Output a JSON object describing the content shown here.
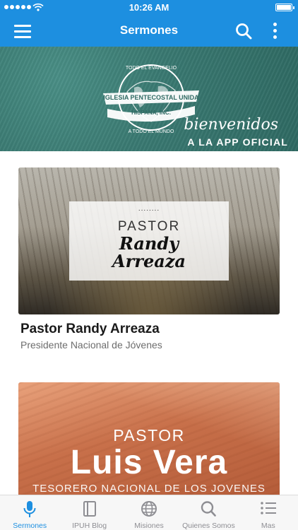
{
  "status_bar": {
    "time": "10:26 AM",
    "signal_icon": "signal-dots-icon",
    "wifi_icon": "wifi-icon",
    "battery_icon": "battery-icon"
  },
  "app_bar": {
    "title": "Sermones",
    "menu_icon": "hamburger-menu-icon",
    "search_icon": "search-icon",
    "more_icon": "more-vertical-icon",
    "background_color": "#1d8fe0"
  },
  "banner": {
    "seal_texts": [
      "TODO EL EVANGELIO",
      "IGLESIA PENTECOSTAL UNIDA",
      "HISPANA, INC.",
      "A TODO EL MUNDO"
    ],
    "welcome": "bienvenidos",
    "subtitle": "A LA APP OFICIAL",
    "background_color": "#3a7a72"
  },
  "cards": [
    {
      "image_dots": "........",
      "image_title": "PASTOR",
      "image_name_line1": "Randy",
      "image_name_line2": "Arreaza",
      "title": "Pastor Randy Arreaza",
      "subtitle": "Presidente Nacional de Jóvenes"
    },
    {
      "image_title": "PASTOR",
      "image_name": "Luis Vera",
      "image_role": "TESORERO NACIONAL DE LOS JOVENES"
    }
  ],
  "tab_bar": {
    "active_color": "#1d8fe0",
    "items": [
      {
        "label": "Sermones",
        "icon": "microphone-icon",
        "active": true
      },
      {
        "label": "IPUH Blog",
        "icon": "book-icon",
        "active": false
      },
      {
        "label": "Misiones",
        "icon": "globe-icon",
        "active": false
      },
      {
        "label": "Quienes Somos",
        "icon": "search-icon",
        "active": false
      },
      {
        "label": "Mas",
        "icon": "list-icon",
        "active": false
      }
    ]
  }
}
